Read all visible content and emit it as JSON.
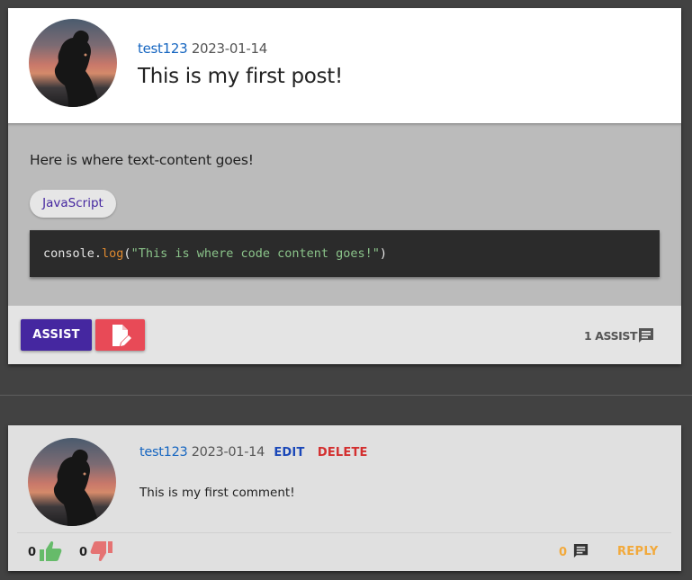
{
  "post": {
    "author": "test123",
    "date": "2023-01-14",
    "title": "This is my first post!",
    "text": "Here is where text-content goes!",
    "language_chip": "JavaScript",
    "code": {
      "prefix": "console.",
      "method": "log",
      "open": "(",
      "string": "\"This is where code content goes!\"",
      "close": ")"
    },
    "assist_button": "ASSIST",
    "edit_icon": "file-edit-icon",
    "assist_count_label": "1 ASSIST",
    "assist_count_icon": "comment-icon"
  },
  "comment": {
    "author": "test123",
    "date": "2023-01-14",
    "edit_label": "EDIT",
    "delete_label": "DELETE",
    "text": "This is my first comment!",
    "upvotes": "0",
    "downvotes": "0",
    "reply_count": "0",
    "reply_label": "REPLY"
  },
  "colors": {
    "page_bg": "#424242",
    "accent_purple": "#4527a0",
    "danger_red": "#e84a57",
    "author_blue": "#1565c0",
    "reply_orange": "#f2a93b",
    "thumb_up_green": "#66bb6a",
    "thumb_down_red": "#e57373"
  }
}
